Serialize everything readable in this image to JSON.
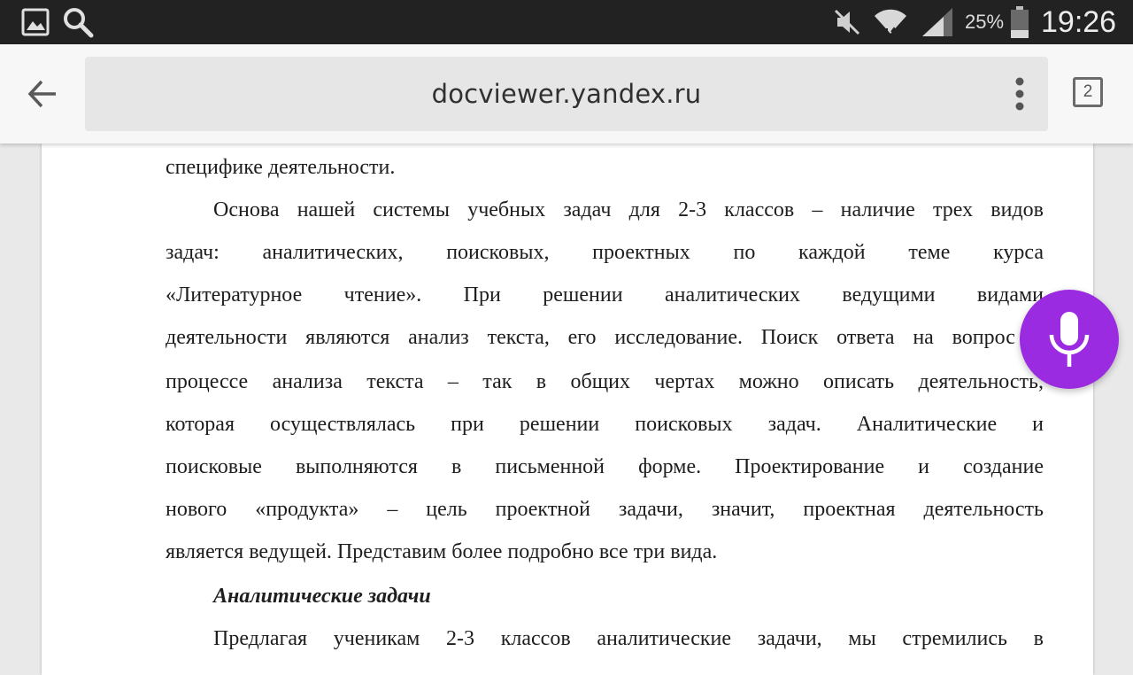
{
  "status_bar": {
    "icons": [
      "gallery-icon",
      "search-icon",
      "mute-icon",
      "wifi-icon",
      "signal-icon",
      "battery-icon"
    ],
    "battery_percent": "25%",
    "time": "19:26"
  },
  "browser": {
    "url": "docviewer.yandex.ru",
    "tab_count": "2",
    "icons": [
      "back-arrow-icon",
      "overflow-menu-icon"
    ]
  },
  "document": {
    "lines": [
      "специфике деятельности.",
      "Основа нашей системы учебных задач для 2-3 классов – наличие трех видов",
      "задач: аналитических, поисковых, проектных по каждой теме курса",
      "«Литературное чтение». При решении аналитических ведущими видами",
      "деятельности являются анализ текста, его исследование. Поиск ответа на вопрос в",
      "процессе анализа текста – так в общих чертах можно описать деятельность,",
      "которая осуществлялась при решении поисковых задач. Аналитические и",
      "поисковые  выполняются в письменной форме. Проектирование и создание",
      "нового «продукта» – цель проектной задачи, значит, проектная деятельность",
      "является ведущей. Представим более подробно все три вида."
    ],
    "heading": "Аналитические задачи",
    "next_line": "Предлагая ученикам 2-3 классов аналитические задачи, мы стремились в"
  },
  "voice_button": {
    "icon": "microphone-icon",
    "color": "#9b2be0"
  }
}
